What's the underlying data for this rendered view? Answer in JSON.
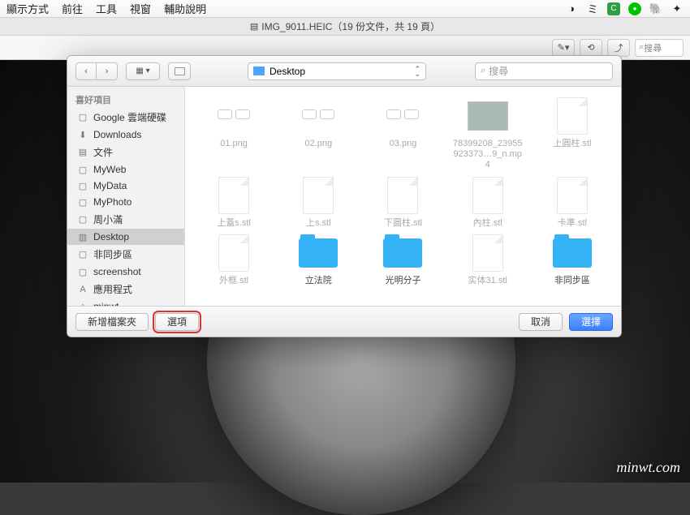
{
  "menubar": {
    "items": [
      "顯示方式",
      "前往",
      "工具",
      "視窗",
      "輔助說明"
    ]
  },
  "window": {
    "title": "IMG_9011.HEIC（19 份文件，共 19 頁）"
  },
  "toolbar": {
    "search_placeholder": "搜尋"
  },
  "dialog": {
    "location": "Desktop",
    "search_placeholder": "搜尋",
    "sidebar": {
      "header": "喜好項目",
      "items": [
        {
          "label": "Google 雲端硬碟",
          "icon": "folder"
        },
        {
          "label": "Downloads",
          "icon": "download"
        },
        {
          "label": "文件",
          "icon": "doc"
        },
        {
          "label": "MyWeb",
          "icon": "folder"
        },
        {
          "label": "MyData",
          "icon": "folder"
        },
        {
          "label": "MyPhoto",
          "icon": "folder"
        },
        {
          "label": "周小滿",
          "icon": "folder"
        },
        {
          "label": "Desktop",
          "icon": "desktop",
          "selected": true
        },
        {
          "label": "非同步區",
          "icon": "folder"
        },
        {
          "label": "screenshot",
          "icon": "folder"
        },
        {
          "label": "應用程式",
          "icon": "apps"
        },
        {
          "label": "minwt",
          "icon": "home"
        }
      ]
    },
    "files": [
      {
        "label": "01.png",
        "type": "glasses",
        "dimmed": true
      },
      {
        "label": "02.png",
        "type": "glasses",
        "dimmed": true
      },
      {
        "label": "03.png",
        "type": "glasses",
        "dimmed": true
      },
      {
        "label": "78399208_23955923373…9_n.mp4",
        "type": "img",
        "dimmed": true
      },
      {
        "label": "上圓柱.stl",
        "type": "doc",
        "dimmed": true
      },
      {
        "label": "上蓋s.stl",
        "type": "doc",
        "dimmed": true
      },
      {
        "label": "上s.stl",
        "type": "doc",
        "dimmed": true
      },
      {
        "label": "下圓柱.stl",
        "type": "doc",
        "dimmed": true
      },
      {
        "label": "內柱.stl",
        "type": "doc",
        "dimmed": true
      },
      {
        "label": "卡準.stl",
        "type": "doc",
        "dimmed": true
      },
      {
        "label": "外框.stl",
        "type": "doc",
        "dimmed": true
      },
      {
        "label": "立法院",
        "type": "folder",
        "dimmed": false
      },
      {
        "label": "光明分子",
        "type": "folder",
        "dimmed": false
      },
      {
        "label": "实体31.stl",
        "type": "doc",
        "dimmed": true
      },
      {
        "label": "非同步區",
        "type": "folder",
        "dimmed": false
      }
    ],
    "buttons": {
      "new_folder": "新增檔案夾",
      "options": "選項",
      "cancel": "取消",
      "choose": "選擇"
    }
  },
  "watermark": "minwt.com"
}
